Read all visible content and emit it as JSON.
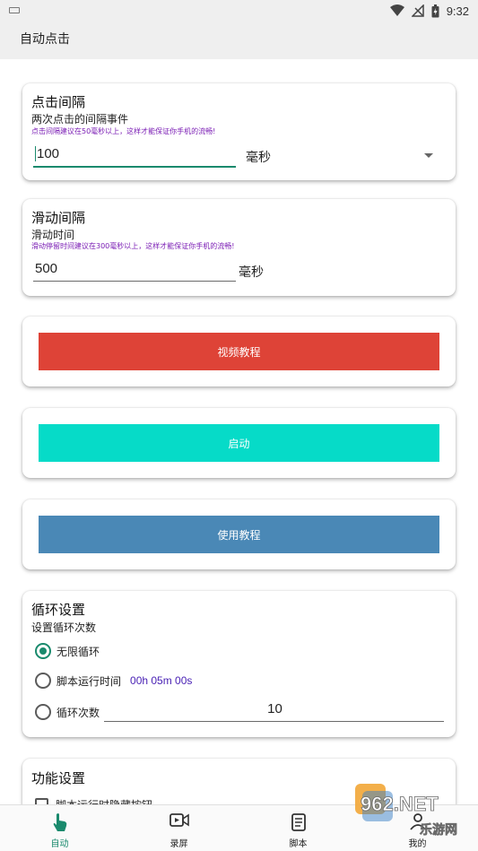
{
  "status_bar": {
    "time": "9:32"
  },
  "app_bar": {
    "title": "自动点击"
  },
  "click_interval": {
    "title": "点击间隔",
    "subtitle": "两次点击的间隔事件",
    "hint": "点击间隔建议在50毫秒以上，这样才能保证你手机的流畅!",
    "value": "100",
    "unit": "毫秒"
  },
  "swipe_interval": {
    "title": "滑动间隔",
    "subtitle": "滑动时间",
    "hint": "滑动停留时间建议在300毫秒以上，这样才能保证你手机的流畅!",
    "value": "500",
    "unit": "毫秒"
  },
  "buttons": {
    "video_tutorial": "视频教程",
    "start": "启动",
    "usage_tutorial": "使用教程"
  },
  "loop_settings": {
    "title": "循环设置",
    "subtitle": "设置循环次数",
    "options": [
      {
        "label": "无限循环",
        "selected": true
      },
      {
        "label": "脚本运行时间",
        "duration": "00h 05m 00s",
        "selected": false
      },
      {
        "label": "循环次数",
        "count": "10",
        "selected": false
      }
    ]
  },
  "function_settings": {
    "title": "功能设置",
    "option_partial": "脚本运行时隐藏按钮"
  },
  "bottom_nav": [
    {
      "label": "自动",
      "icon": "hand-tap-icon",
      "active": true
    },
    {
      "label": "录屏",
      "icon": "screen-record-icon",
      "active": false
    },
    {
      "label": "脚本",
      "icon": "script-scroll-icon",
      "active": false
    },
    {
      "label": "我的",
      "icon": "profile-icon",
      "active": false
    }
  ],
  "watermark": {
    "text_top": "962.NET",
    "text_bottom": "乐游网"
  },
  "colors": {
    "accent": "#1a8a6d",
    "video_button": "#de4337",
    "start_button": "#06dbc8",
    "usage_button": "#4a88b6",
    "hint_text": "#7a1cb4",
    "duration_text": "#4a22b5"
  }
}
